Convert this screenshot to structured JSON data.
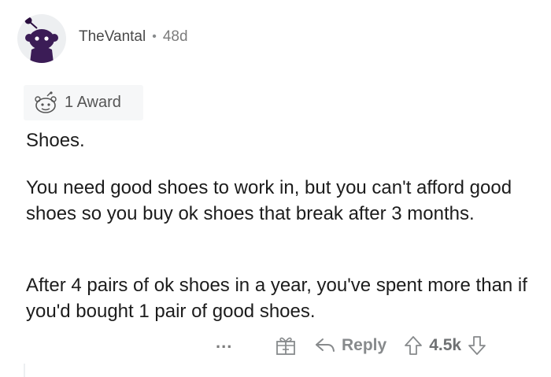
{
  "comment": {
    "username": "TheVantal",
    "separator": "•",
    "age": "48d",
    "award_label": "1 Award",
    "paragraphs": [
      "Shoes.",
      "You need good shoes to work in, but you can't afford good shoes so you buy ok shoes that break after 3 months.",
      "After 4 pairs of ok shoes in a year, you've spent more than if you'd bought 1 pair of good shoes."
    ],
    "actions": {
      "more_label": "...",
      "reply_label": "Reply",
      "score": "4.5k"
    }
  },
  "icons": {
    "avatar": "snoo-avatar",
    "award": "award-icon",
    "give_award": "gift-icon",
    "reply": "reply-arrow-icon",
    "upvote": "upvote-arrow-icon",
    "downvote": "downvote-arrow-icon"
  },
  "colors": {
    "avatar_bg": "#edeff1",
    "snoo": "#3b1c56",
    "text": "#1c1c1c",
    "muted": "#878a8c"
  }
}
